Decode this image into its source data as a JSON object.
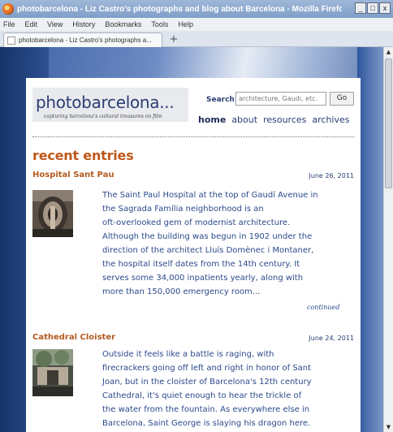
{
  "window": {
    "title": "photobarcelona - Liz Castro's photographs and blog about Barcelona - Mozilla Firefox",
    "min_label": "_",
    "max_label": "□",
    "close_label": "x"
  },
  "menu": [
    "File",
    "Edit",
    "View",
    "History",
    "Bookmarks",
    "Tools",
    "Help"
  ],
  "tab": {
    "label": "photobarcelona - Liz Castro's photographs a..."
  },
  "newtab_label": "+",
  "scroll": {
    "up": "▲",
    "down": "▼"
  },
  "site": {
    "title": "photobarcelona...",
    "tagline": "capturing barcelona's cultural treasures on film"
  },
  "search": {
    "label": "Search:",
    "placeholder": "architecture, Gaudi, etc.",
    "button": "Go"
  },
  "nav": [
    "home",
    "about",
    "resources",
    "archives"
  ],
  "section_title": "recent entries",
  "entries": [
    {
      "title": "Hospital Sant Pau",
      "date": "June 26, 2011",
      "lines": [
        "The Saint Paul Hospital at the top of Gaudí Avenue in",
        "the Sagrada Família neighborhood is an",
        "oft-overlooked gem of modernist architecture.",
        "Although the building was begun in 1902 under the",
        "direction of the architect Lluís Domènec i Montaner,",
        "the hospital itself dates from the 14th century. It",
        "serves some 34,000 inpatients yearly, along with",
        "more than 150,000 emergency room..."
      ],
      "continued": "continued",
      "thumb_icon": "photo-thumbnail-icon"
    },
    {
      "title": "Cathedral Cloister",
      "date": "June 24, 2011",
      "lines": [
        "Outside it feels like a battle is raging, with",
        "firecrackers going off left and right in honor of Sant",
        "Joan, but in the cloister of Barcelona's 12th century",
        "Cathedral, it's quiet enough to hear the trickle of",
        "the water from the fountain. As everywhere else in",
        "Barcelona, Saint George is slaying his dragon here."
      ],
      "thumb_icon": "photo-thumbnail-icon"
    }
  ],
  "colors": {
    "title_blue": "#2b3d73",
    "accent_orange": "#c0581a",
    "text_blue": "#2b4a8a"
  }
}
